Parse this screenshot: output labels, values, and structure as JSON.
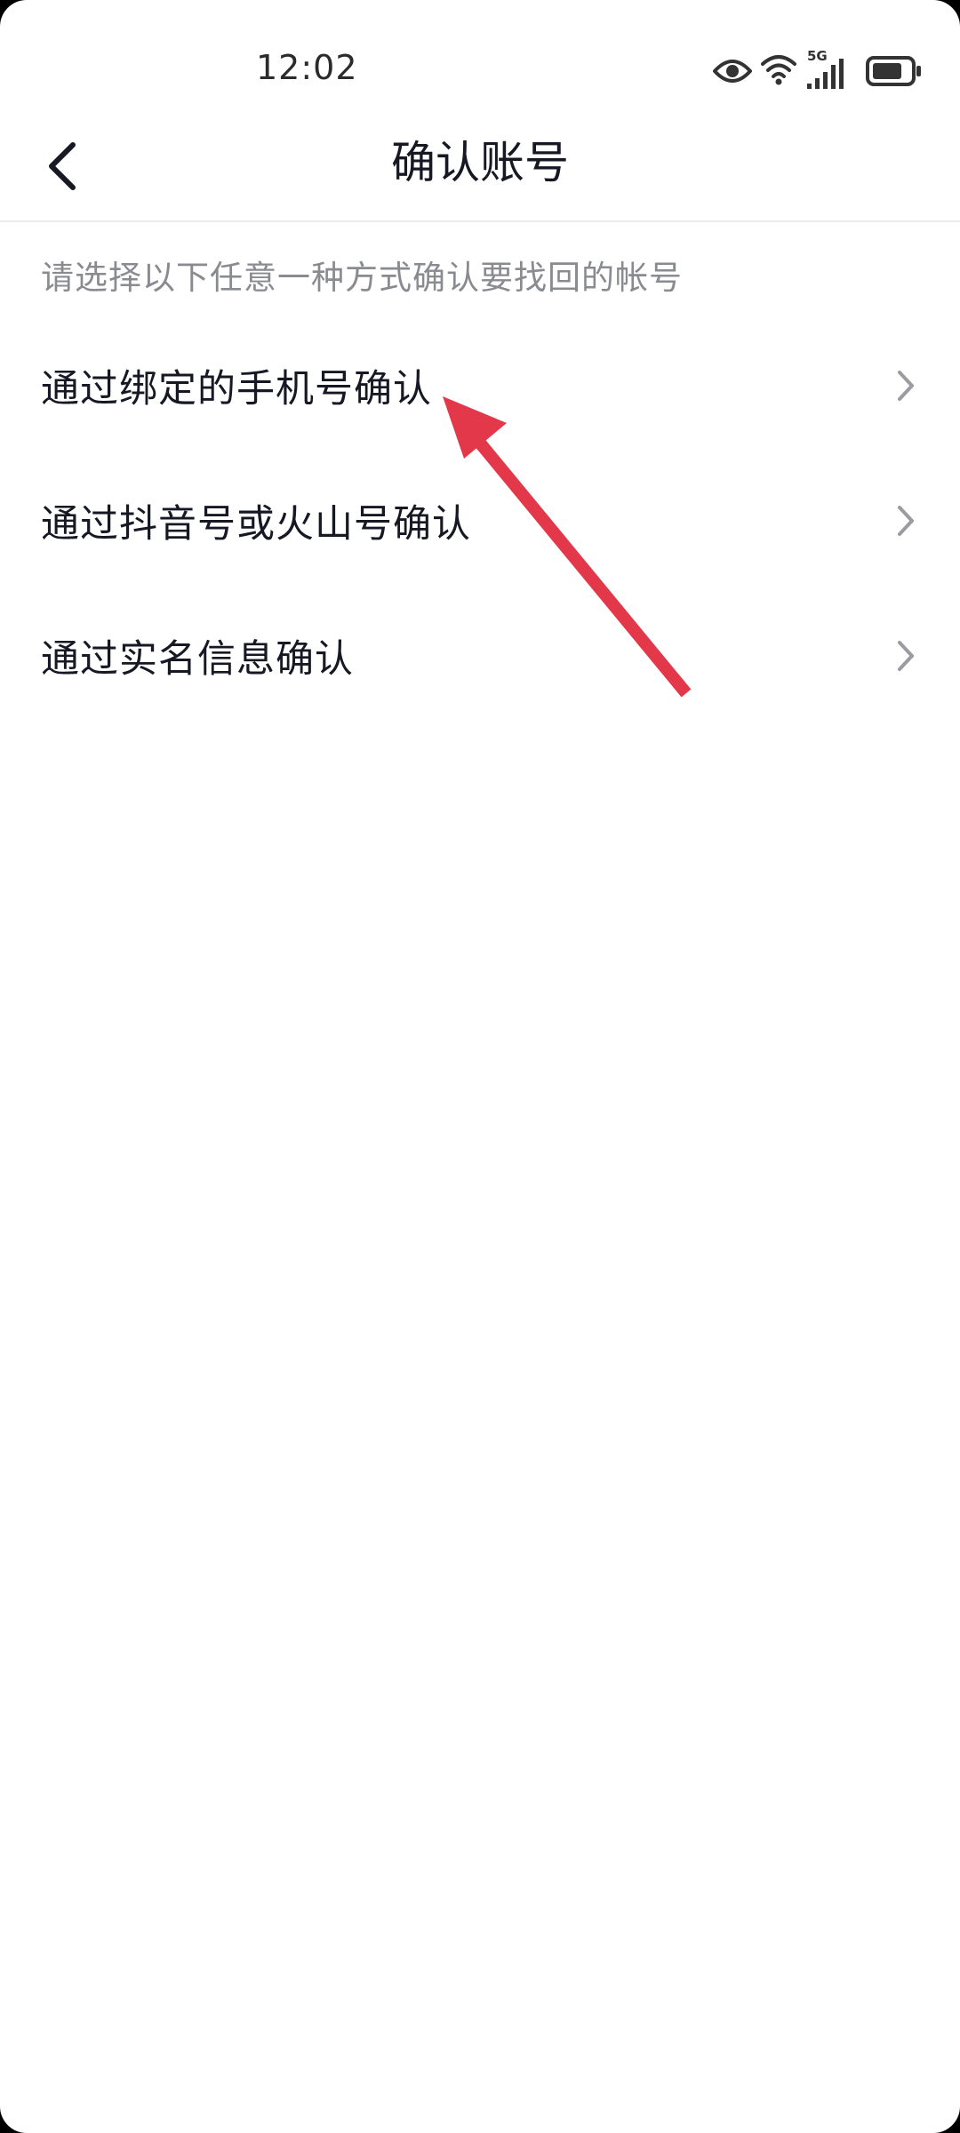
{
  "status_bar": {
    "time": "12:02",
    "network_label": "5G",
    "icons": [
      "eye-icon",
      "wifi-icon",
      "cellular-signal-icon",
      "battery-icon"
    ]
  },
  "nav": {
    "back_icon": "chevron-left-icon",
    "title": "确认账号"
  },
  "hint": "请选择以下任意一种方式确认要找回的帐号",
  "options": [
    {
      "label": "通过绑定的手机号确认",
      "icon": "chevron-right-icon"
    },
    {
      "label": "通过抖音号或火山号确认",
      "icon": "chevron-right-icon"
    },
    {
      "label": "通过实名信息确认",
      "icon": "chevron-right-icon"
    }
  ],
  "colors": {
    "text_primary": "#161823",
    "text_secondary": "#8a8b91",
    "chevron": "#9b9ca1",
    "annotation_arrow": "#e3374a",
    "divider": "#ececec"
  }
}
